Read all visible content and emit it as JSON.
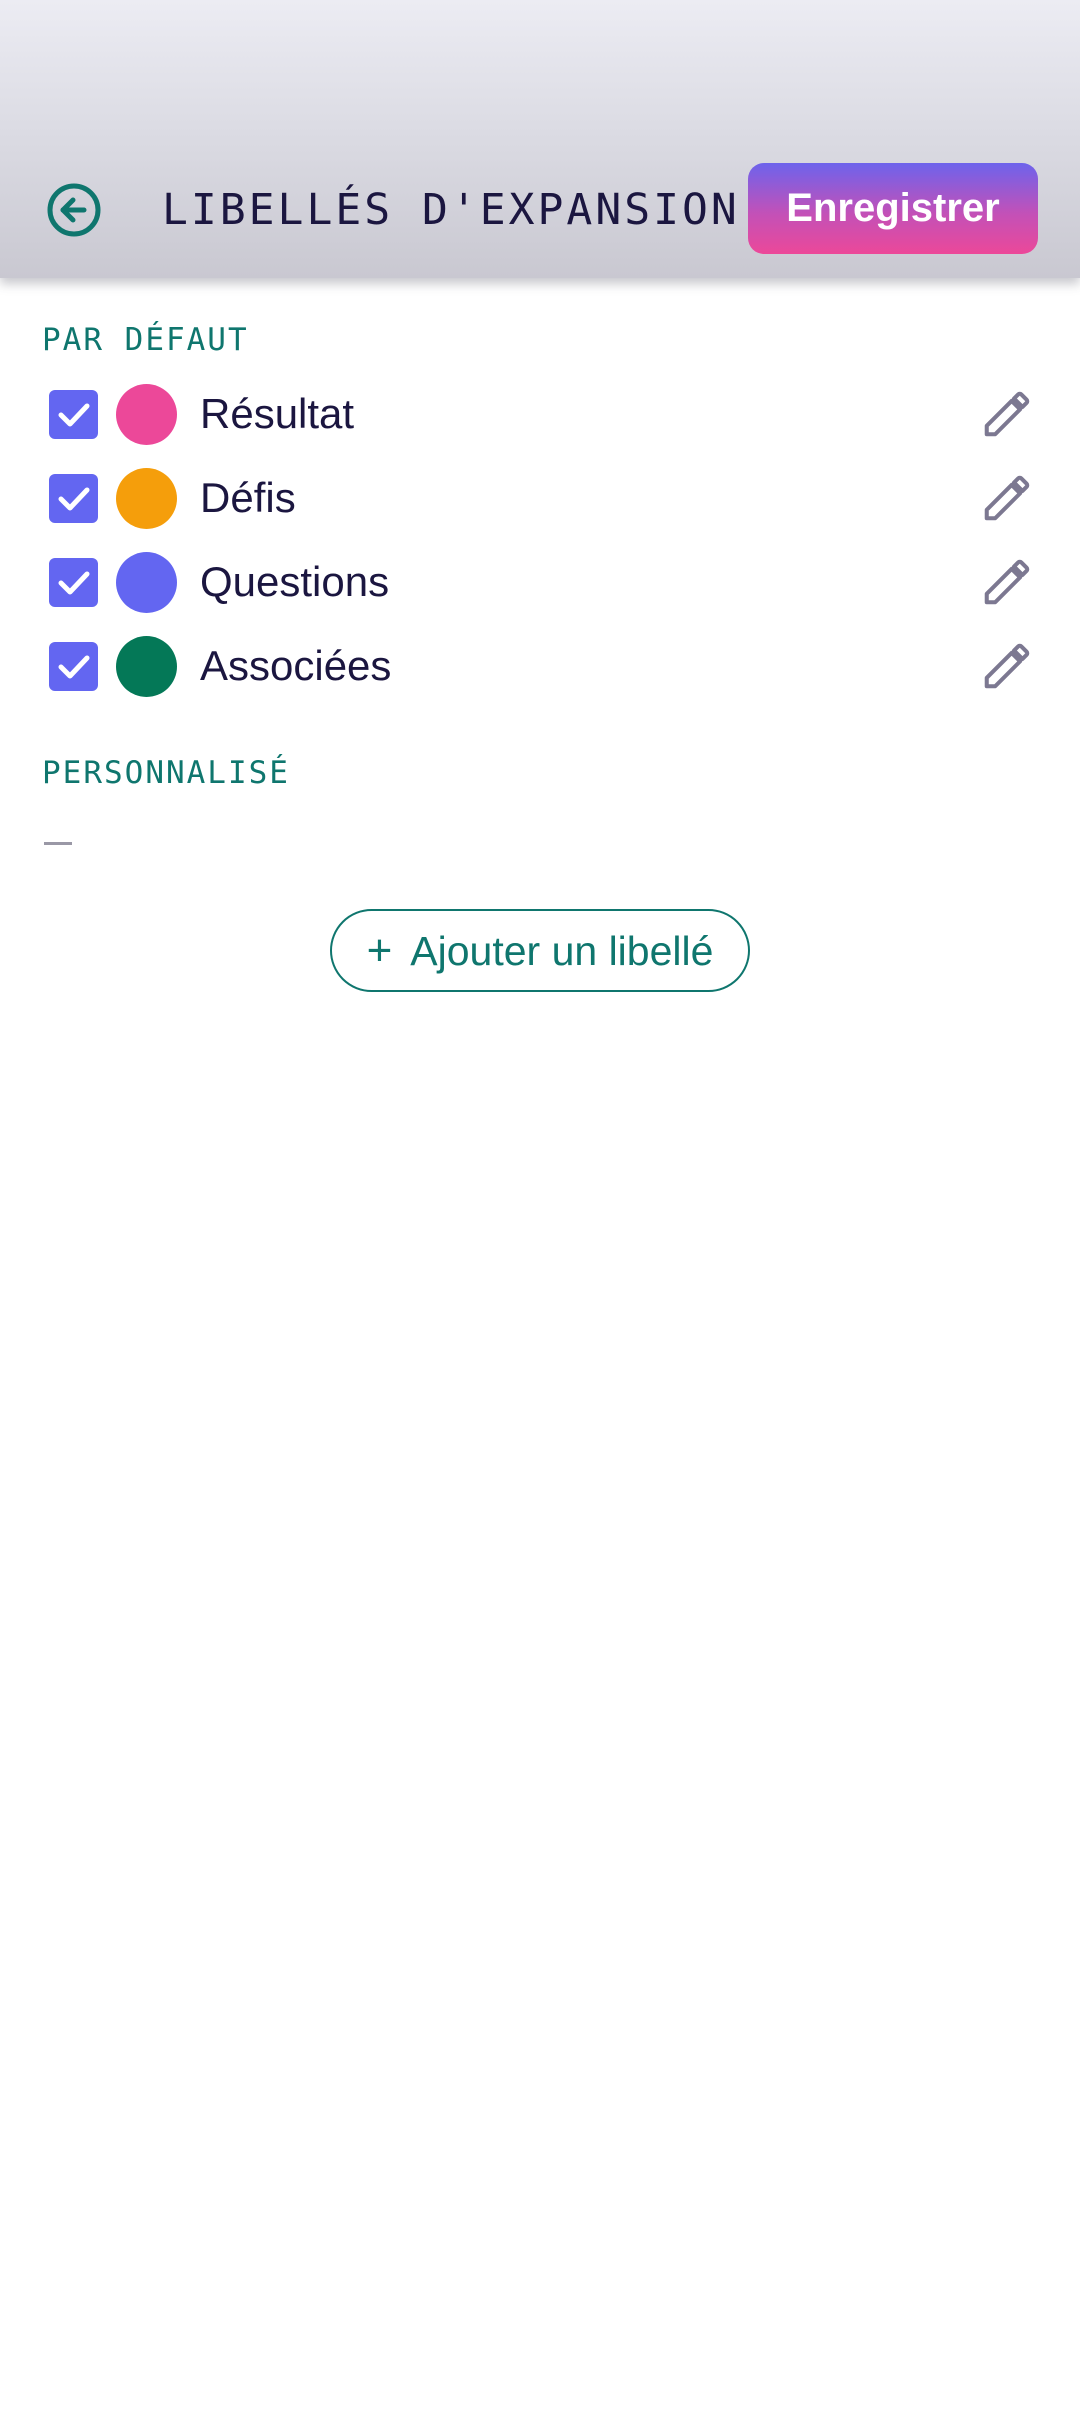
{
  "header": {
    "title": "LIBELLÉS D'EXPANSION",
    "back_icon": "arrow-left-circle-icon",
    "save_label": "Enregistrer"
  },
  "sections": {
    "default_label": "PAR DÉFAUT",
    "custom_label": "PERSONNALISÉ",
    "custom_empty": "—"
  },
  "labels": [
    {
      "name": "Résultat",
      "color": "#ec4899",
      "checked": true,
      "edit_icon": "pencil-icon"
    },
    {
      "name": "Défis",
      "color": "#f59e0b",
      "checked": true,
      "edit_icon": "pencil-icon"
    },
    {
      "name": "Questions",
      "color": "#6366f1",
      "checked": true,
      "edit_icon": "pencil-icon"
    },
    {
      "name": "Associées",
      "color": "#047857",
      "checked": true,
      "edit_icon": "pencil-icon"
    }
  ],
  "add_button": {
    "icon": "+",
    "label": "Ajouter un libellé"
  },
  "colors": {
    "accent_teal": "#0f766e",
    "checkbox": "#6366f1",
    "text_dark": "#1b1640",
    "icon_gray": "#7c7891"
  }
}
